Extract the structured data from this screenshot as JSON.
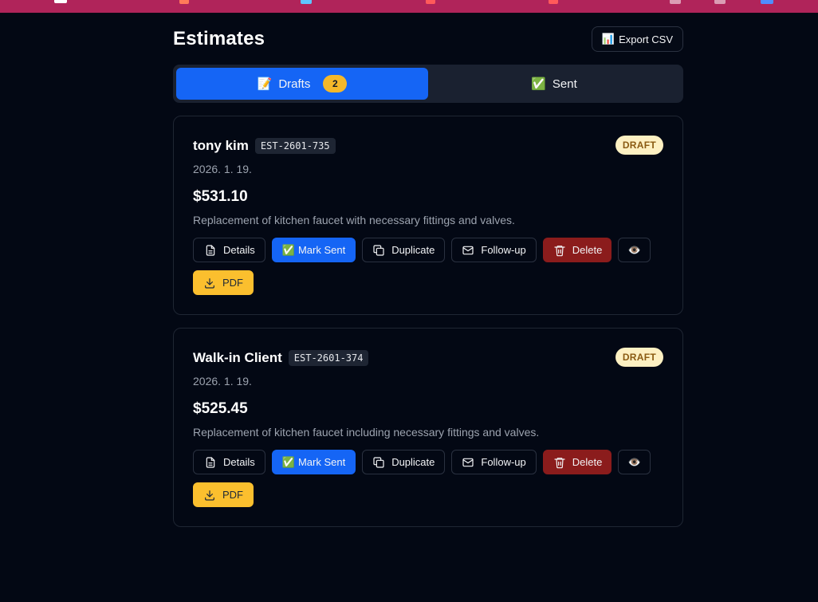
{
  "header": {
    "title": "Estimates",
    "export_icon": "📊",
    "export_label": "Export CSV"
  },
  "tabs": [
    {
      "icon": "📝",
      "label": "Drafts",
      "count": "2",
      "active": true
    },
    {
      "icon": "✅",
      "label": "Sent",
      "active": false
    }
  ],
  "estimates": [
    {
      "client": "tony kim",
      "code": "EST-2601-735",
      "status": "DRAFT",
      "date": "2026. 1. 19.",
      "amount": "$531.10",
      "description": "Replacement of kitchen faucet with necessary fittings and valves.",
      "actions": {
        "details": "Details",
        "mark_sent": "Mark Sent",
        "mark_sent_icon": "✅",
        "duplicate": "Duplicate",
        "follow_up": "Follow-up",
        "delete": "Delete",
        "preview_icon": "👁️",
        "pdf": "PDF"
      }
    },
    {
      "client": "Walk-in Client",
      "code": "EST-2601-374",
      "status": "DRAFT",
      "date": "2026. 1. 19.",
      "amount": "$525.45",
      "description": "Replacement of kitchen faucet including necessary fittings and valves.",
      "actions": {
        "details": "Details",
        "mark_sent": "Mark Sent",
        "mark_sent_icon": "✅",
        "duplicate": "Duplicate",
        "follow_up": "Follow-up",
        "delete": "Delete",
        "preview_icon": "👁️",
        "pdf": "PDF"
      }
    }
  ],
  "colors": {
    "background": "#030814",
    "primary": "#1565f5",
    "danger": "#8b1c1c",
    "pdf": "#fbbf2e",
    "draft_badge_bg": "#fdf0c2",
    "draft_badge_text": "#8a5a12",
    "browser_bar": "#b0245a"
  }
}
